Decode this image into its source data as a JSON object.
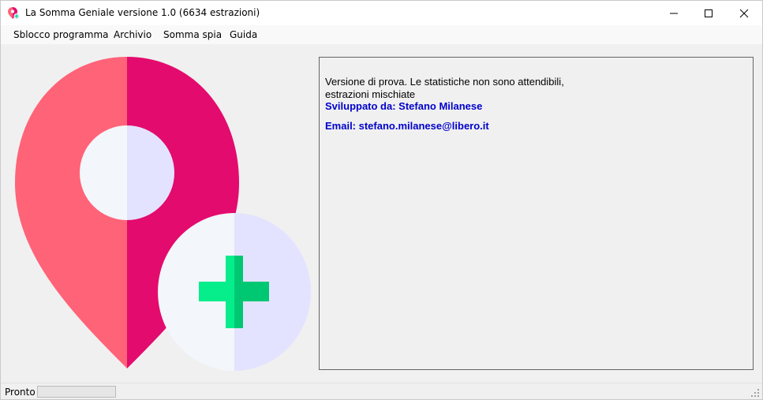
{
  "window": {
    "title": "La Somma Geniale versione 1.0 (6634 estrazioni)"
  },
  "menu": {
    "items": [
      "Sblocco programma",
      "Archivio",
      "Somma spia",
      "Guida"
    ]
  },
  "info": {
    "line1": "Versione di prova. Le statistiche non sono attendibili,",
    "line2": "estrazioni mischiate",
    "developer": "Sviluppato da: Stefano Milanese",
    "email": "Email: stefano.milanese@libero.it"
  },
  "status": {
    "text": "Pronto",
    "progress": 0
  },
  "colors": {
    "pin_left": "#ff6378",
    "pin_right": "#e30b6e",
    "circle_left": "#f3f6fa",
    "circle_right": "#e3e3ff",
    "plus_left": "#05ee8b",
    "plus_right": "#00c872",
    "link_blue": "#0000cc"
  },
  "icons": {
    "app": "map-pin-plus-icon",
    "logo": "map-pin-plus-icon",
    "minimize": "minimize-icon",
    "maximize": "maximize-icon",
    "close": "close-icon",
    "grip": "resize-grip-icon"
  }
}
